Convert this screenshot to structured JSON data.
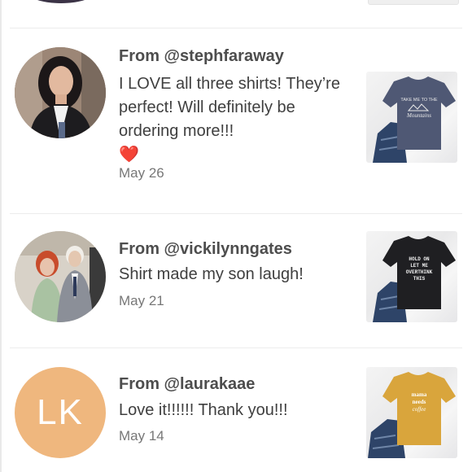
{
  "reviews": [
    {
      "handle": "From @stephfaraway",
      "message": "I LOVE all three shirts! They’re perfect! Will definitely be ordering more!!!",
      "emoji": "❤️",
      "date": "May 26",
      "avatar_type": "photo",
      "shirt": {
        "color": "#4f5874",
        "print": "TAKE ME TO THE Mountains"
      }
    },
    {
      "handle": "From @vickilynngates",
      "message": "Shirt made my son laugh!",
      "date": "May 21",
      "avatar_type": "photo",
      "shirt": {
        "color": "#1f1f22",
        "print": "HOLD ON LET ME OVERTHINK THIS"
      }
    },
    {
      "handle": "From @laurakaae",
      "message": "Love it!!!!!! Thank you!!!",
      "date": "May 14",
      "avatar_type": "initials",
      "initials": "LK",
      "avatar_color": "#efb77e",
      "shirt": {
        "color": "#d9a53c",
        "print": "mama needs coffee"
      }
    }
  ]
}
